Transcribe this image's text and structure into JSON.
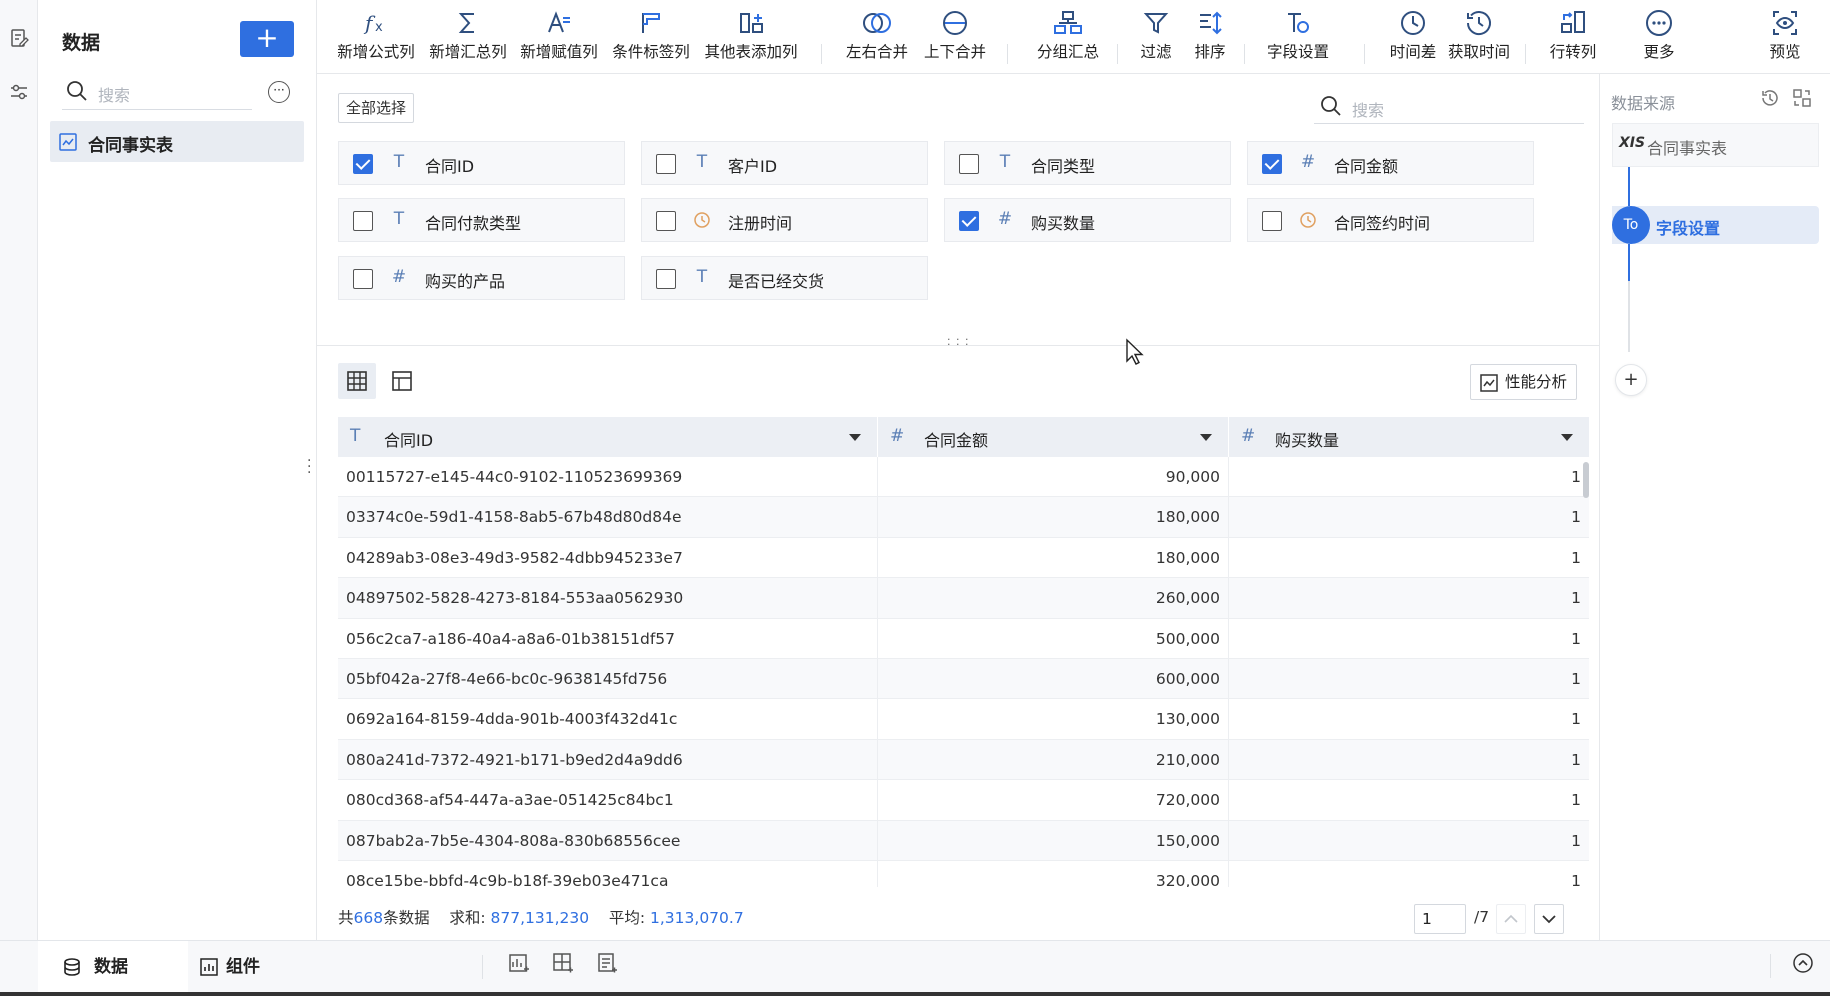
{
  "left_panel": {
    "title": "数据",
    "add_label": "+",
    "search_placeholder": "搜索",
    "items": [
      {
        "label": "合同事实表"
      }
    ]
  },
  "toolbar": {
    "items": [
      {
        "label": "新增公式列",
        "icon": "fx-icon"
      },
      {
        "label": "新增汇总列",
        "icon": "sigma-icon"
      },
      {
        "label": "新增赋值列",
        "icon": "assign-icon"
      },
      {
        "label": "条件标签列",
        "icon": "flag-icon"
      },
      {
        "label": "其他表添加列",
        "icon": "add-column-icon"
      },
      {
        "label": "左右合并",
        "icon": "venn-icon"
      },
      {
        "label": "上下合并",
        "icon": "stack-merge-icon"
      },
      {
        "label": "分组汇总",
        "icon": "group-icon"
      },
      {
        "label": "过滤",
        "icon": "filter-icon"
      },
      {
        "label": "排序",
        "icon": "sort-icon"
      },
      {
        "label": "字段设置",
        "icon": "field-settings-icon"
      },
      {
        "label": "时间差",
        "icon": "clock-icon"
      },
      {
        "label": "获取时间",
        "icon": "clock-arrow-icon"
      },
      {
        "label": "行转列",
        "icon": "pivot-icon"
      },
      {
        "label": "更多",
        "icon": "more-icon"
      },
      {
        "label": "预览",
        "icon": "preview-icon"
      }
    ]
  },
  "fields": {
    "select_all": "全部选择",
    "search_placeholder": "搜索",
    "items": [
      {
        "name": "合同ID",
        "type": "T",
        "checked": true
      },
      {
        "name": "客户ID",
        "type": "T",
        "checked": false
      },
      {
        "name": "合同类型",
        "type": "T",
        "checked": false
      },
      {
        "name": "合同金额",
        "type": "#",
        "checked": true
      },
      {
        "name": "合同付款类型",
        "type": "T",
        "checked": false
      },
      {
        "name": "注册时间",
        "type": "time",
        "checked": false
      },
      {
        "name": "购买数量",
        "type": "#",
        "checked": true
      },
      {
        "name": "合同签约时间",
        "type": "time",
        "checked": false
      },
      {
        "name": "购买的产品",
        "type": "#",
        "checked": false
      },
      {
        "name": "是否已经交货",
        "type": "T",
        "checked": false
      }
    ]
  },
  "preview": {
    "perf_label": "性能分析",
    "columns": [
      {
        "name": "合同ID",
        "type": "T"
      },
      {
        "name": "合同金额",
        "type": "#"
      },
      {
        "name": "购买数量",
        "type": "#"
      }
    ],
    "rows": [
      [
        "00115727-e145-44c0-9102-110523699369",
        "90,000",
        "1"
      ],
      [
        "03374c0e-59d1-4158-8ab5-67b48d80d84e",
        "180,000",
        "1"
      ],
      [
        "04289ab3-08e3-49d3-9582-4dbb945233e7",
        "180,000",
        "1"
      ],
      [
        "04897502-5828-4273-8184-553aa0562930",
        "260,000",
        "1"
      ],
      [
        "056c2ca7-a186-40a4-a8a6-01b38151df57",
        "500,000",
        "1"
      ],
      [
        "05bf042a-27f8-4e66-bc0c-9638145fd756",
        "600,000",
        "1"
      ],
      [
        "0692a164-8159-4dda-901b-4003f432d41c",
        "130,000",
        "1"
      ],
      [
        "080a241d-7372-4921-b171-b9ed2d4a9dd6",
        "210,000",
        "1"
      ],
      [
        "080cd368-af54-447a-a3ae-051425c84bc1",
        "720,000",
        "1"
      ],
      [
        "087bab2a-7b5e-4304-808a-830b68556cee",
        "150,000",
        "1"
      ],
      [
        "08ce15be-bbfd-4c9b-b18f-39eb03e471ca",
        "320,000",
        "1"
      ]
    ]
  },
  "status": {
    "count_prefix": "共",
    "count": "668",
    "count_suffix": "条数据",
    "sum_label": "求和:",
    "sum_value": "877,131,230",
    "avg_label": "平均:",
    "avg_value": "1,313,070.7",
    "page_current": "1",
    "page_total": "/7"
  },
  "right_panel": {
    "title": "数据来源",
    "source_icon_text": "XIS",
    "source": "合同事实表",
    "step_icon_text": "To",
    "step": "字段设置",
    "add_label": "+"
  },
  "bottom": {
    "tab_data": "数据",
    "tab_component": "组件"
  },
  "colors": {
    "accent": "#2f6fe0"
  }
}
